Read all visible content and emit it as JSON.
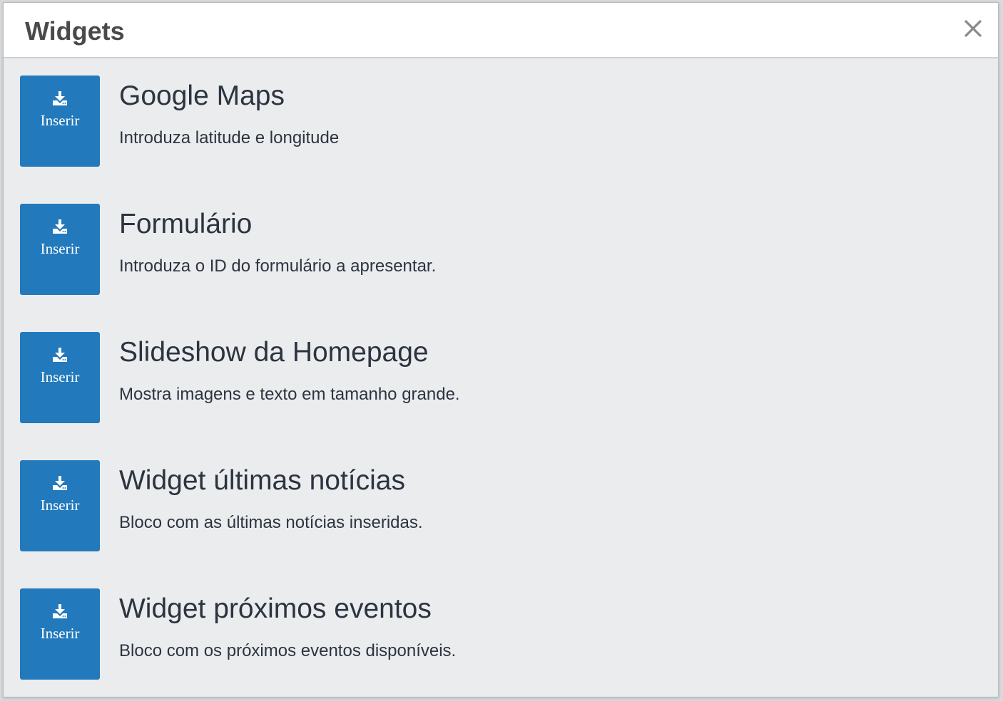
{
  "modal": {
    "title": "Widgets",
    "close_icon": "close-icon"
  },
  "colors": {
    "button_bg": "#2279bc",
    "text": "#2c3440",
    "panel_bg": "#ebecee"
  },
  "widgets": [
    {
      "button_label": "Inserir",
      "button_icon": "download-icon",
      "title": "Google Maps",
      "description": "Introduza latitude e longitude"
    },
    {
      "button_label": "Inserir",
      "button_icon": "download-icon",
      "title": "Formulário",
      "description": "Introduza o ID do formulário a apresentar."
    },
    {
      "button_label": "Inserir",
      "button_icon": "download-icon",
      "title": "Slideshow da Homepage",
      "description": "Mostra imagens e texto em tamanho grande."
    },
    {
      "button_label": "Inserir",
      "button_icon": "download-icon",
      "title": "Widget últimas notícias",
      "description": "Bloco com as últimas notícias inseridas."
    },
    {
      "button_label": "Inserir",
      "button_icon": "download-icon",
      "title": "Widget próximos eventos",
      "description": "Bloco com os próximos eventos disponíveis."
    }
  ]
}
